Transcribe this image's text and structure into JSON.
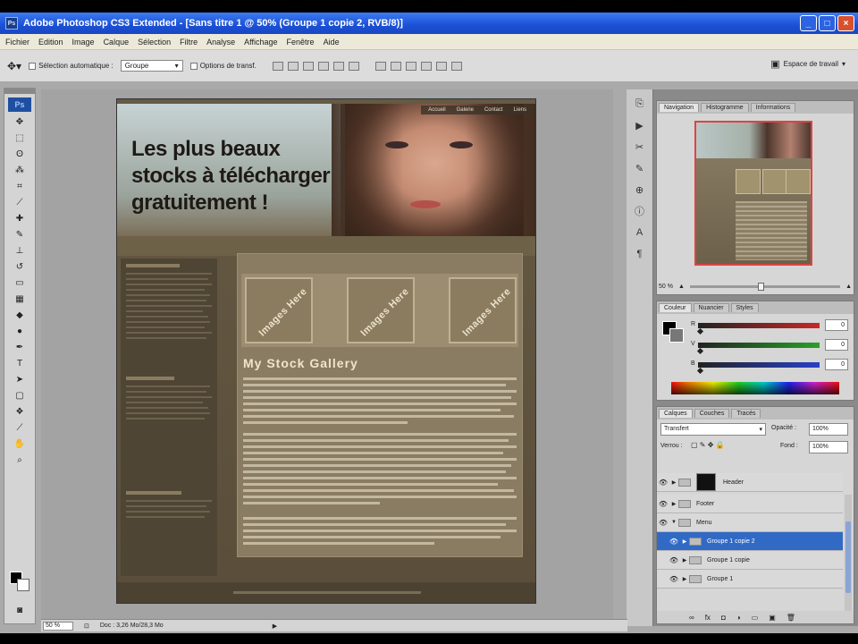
{
  "window": {
    "title": "Adobe Photoshop CS3 Extended - [Sans titre 1 @ 50% (Groupe 1 copie 2, RVB/8)]",
    "icon": "ps-app-icon",
    "controls": [
      "minimize",
      "maximize",
      "close"
    ]
  },
  "menu": [
    "Fichier",
    "Edition",
    "Image",
    "Calque",
    "Sélection",
    "Filtre",
    "Analyse",
    "Affichage",
    "Fenêtre",
    "Aide"
  ],
  "options_bar": {
    "auto_select_label": "Sélection automatique :",
    "auto_select_value": "Groupe",
    "transform_label": "Options de transf.",
    "workspace_label": "Espace de travail"
  },
  "document": {
    "topnav": [
      "Accueil",
      "Galerie",
      "Contact",
      "Liens"
    ],
    "slogan": [
      "Les plus beaux",
      "stocks à télécharger",
      "gratuitement !"
    ],
    "thumb_label": "Images Here",
    "gallery_title": "My Stock Gallery"
  },
  "panels": {
    "navigator_tabs": [
      "Navigation",
      "Histogramme",
      "Informations"
    ],
    "navigator_zoom": "50 %",
    "color_tabs": [
      "Couleur",
      "Nuancier",
      "Styles"
    ],
    "color_channels": [
      {
        "label": "R",
        "value": "0",
        "color": "#c82828"
      },
      {
        "label": "V",
        "value": "0",
        "color": "#28a028"
      },
      {
        "label": "B",
        "value": "0",
        "color": "#2840c8"
      }
    ],
    "layers_tabs": [
      "Calques",
      "Couches",
      "Tracés"
    ],
    "blend_mode": "Transfert",
    "opacity_label": "Opacité :",
    "opacity_value": "100%",
    "lock_label": "Verrou :",
    "fill_label": "Fond :",
    "fill_value": "100%",
    "layers": [
      {
        "name": "Header",
        "type": "layer-thumb",
        "selected": false
      },
      {
        "name": "Footer",
        "type": "folder",
        "selected": false
      },
      {
        "name": "Menu",
        "type": "folder",
        "selected": false
      },
      {
        "name": "Groupe 1 copie 2",
        "type": "folder",
        "selected": true
      },
      {
        "name": "Groupe 1 copie",
        "type": "folder",
        "selected": false
      },
      {
        "name": "Groupe 1",
        "type": "folder",
        "selected": false
      }
    ]
  },
  "status": {
    "zoom": "50 %",
    "doc_info": "Doc : 3,26 Mo/28,3 Mo"
  }
}
